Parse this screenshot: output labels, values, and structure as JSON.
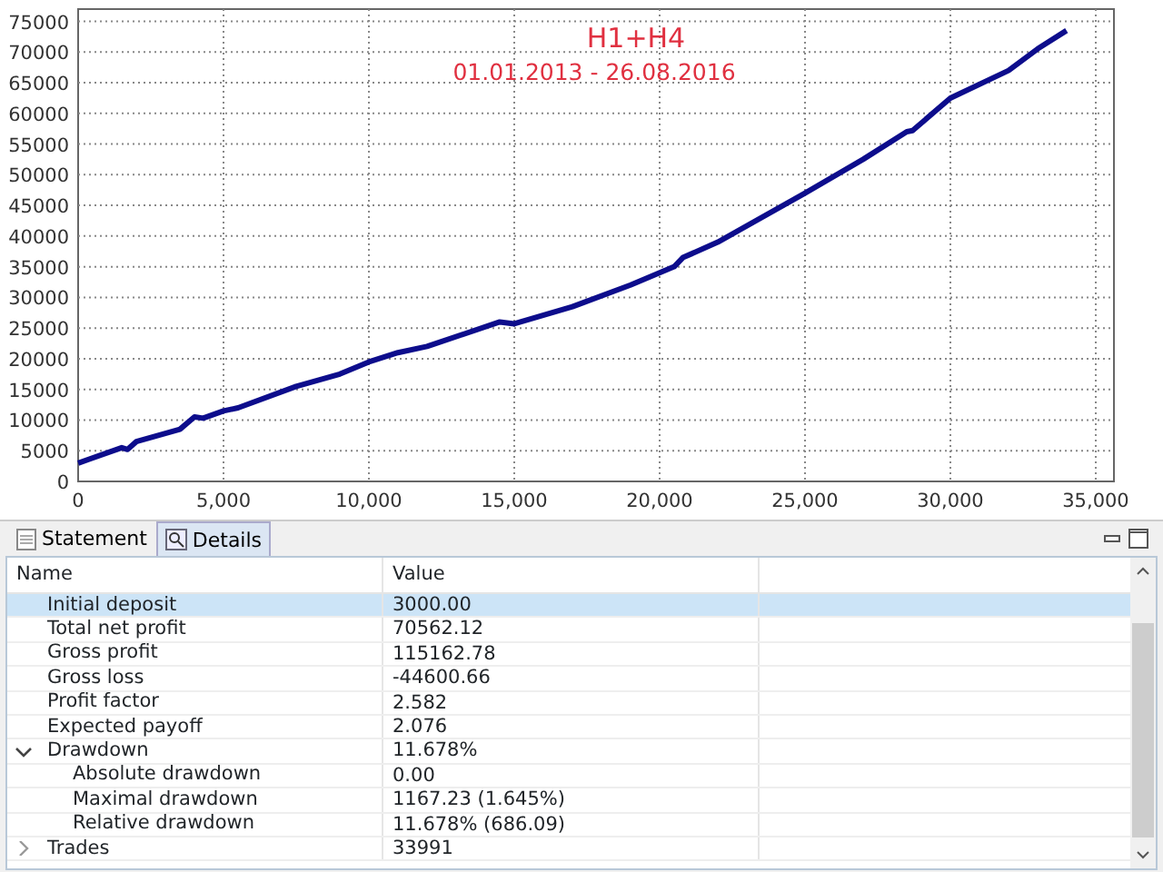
{
  "chart": {
    "subtitle": "01.01.2013 - 26.08.2016",
    "chart_data": {
      "type": "line",
      "title": "H1+H4",
      "xlim": [
        0,
        35000
      ],
      "ylim": [
        0,
        77000
      ],
      "xticks": [
        {
          "value": 0,
          "label": "0"
        },
        {
          "value": 5000,
          "label": "5,000"
        },
        {
          "value": 10000,
          "label": "10,000"
        },
        {
          "value": 15000,
          "label": "15,000"
        },
        {
          "value": 20000,
          "label": "20,000"
        },
        {
          "value": 25000,
          "label": "25,000"
        },
        {
          "value": 30000,
          "label": "30,000"
        },
        {
          "value": 35000,
          "label": "35,000"
        }
      ],
      "yticks": [
        0,
        5000,
        10000,
        15000,
        20000,
        25000,
        30000,
        35000,
        40000,
        45000,
        50000,
        55000,
        60000,
        65000,
        70000,
        75000
      ],
      "x": [
        0,
        1500,
        1700,
        2000,
        3500,
        4000,
        4300,
        5000,
        5500,
        7500,
        9000,
        10000,
        11000,
        12000,
        14500,
        15000,
        17000,
        19000,
        20500,
        20800,
        22000,
        25000,
        27000,
        28500,
        28700,
        30000,
        32000,
        33000,
        33991
      ],
      "grid": true,
      "series": [
        {
          "color": "#0d0d8c",
          "values": [
            3000,
            5500,
            5200,
            6500,
            8500,
            10500,
            10300,
            11500,
            12000,
            15500,
            17500,
            19500,
            21000,
            22000,
            26000,
            25700,
            28500,
            32000,
            35000,
            36500,
            39000,
            47000,
            52500,
            57000,
            57200,
            62500,
            67000,
            70500,
            73500
          ]
        }
      ]
    }
  },
  "panel": {
    "tabs": [
      {
        "label": "Statement",
        "selected": false
      },
      {
        "label": "Details",
        "selected": true
      }
    ],
    "columns": [
      "Name",
      "Value"
    ],
    "rows": [
      {
        "name": "Initial deposit",
        "value": "3000.00",
        "selected": true
      },
      {
        "name": "Total net profit",
        "value": "70562.12",
        "selected": false
      },
      {
        "name": "Gross profit",
        "value": "115162.78",
        "selected": false
      },
      {
        "name": "Gross loss",
        "value": "-44600.66",
        "selected": false
      },
      {
        "name": "Profit factor",
        "value": "2.582",
        "selected": false
      },
      {
        "name": "Expected payoff",
        "value": "2.076",
        "selected": false
      },
      {
        "name": "Drawdown",
        "value": "11.678%",
        "selected": false,
        "expanded": true,
        "children": [
          {
            "name": "Absolute drawdown",
            "value": "0.00",
            "selected": false
          },
          {
            "name": "Maximal drawdown",
            "value": "1167.23 (1.645%)",
            "selected": false
          },
          {
            "name": "Relative drawdown",
            "value": "11.678% (686.09)",
            "selected": false
          }
        ]
      },
      {
        "name": "Trades",
        "value": "33991",
        "selected": false,
        "expanded": false
      }
    ]
  }
}
